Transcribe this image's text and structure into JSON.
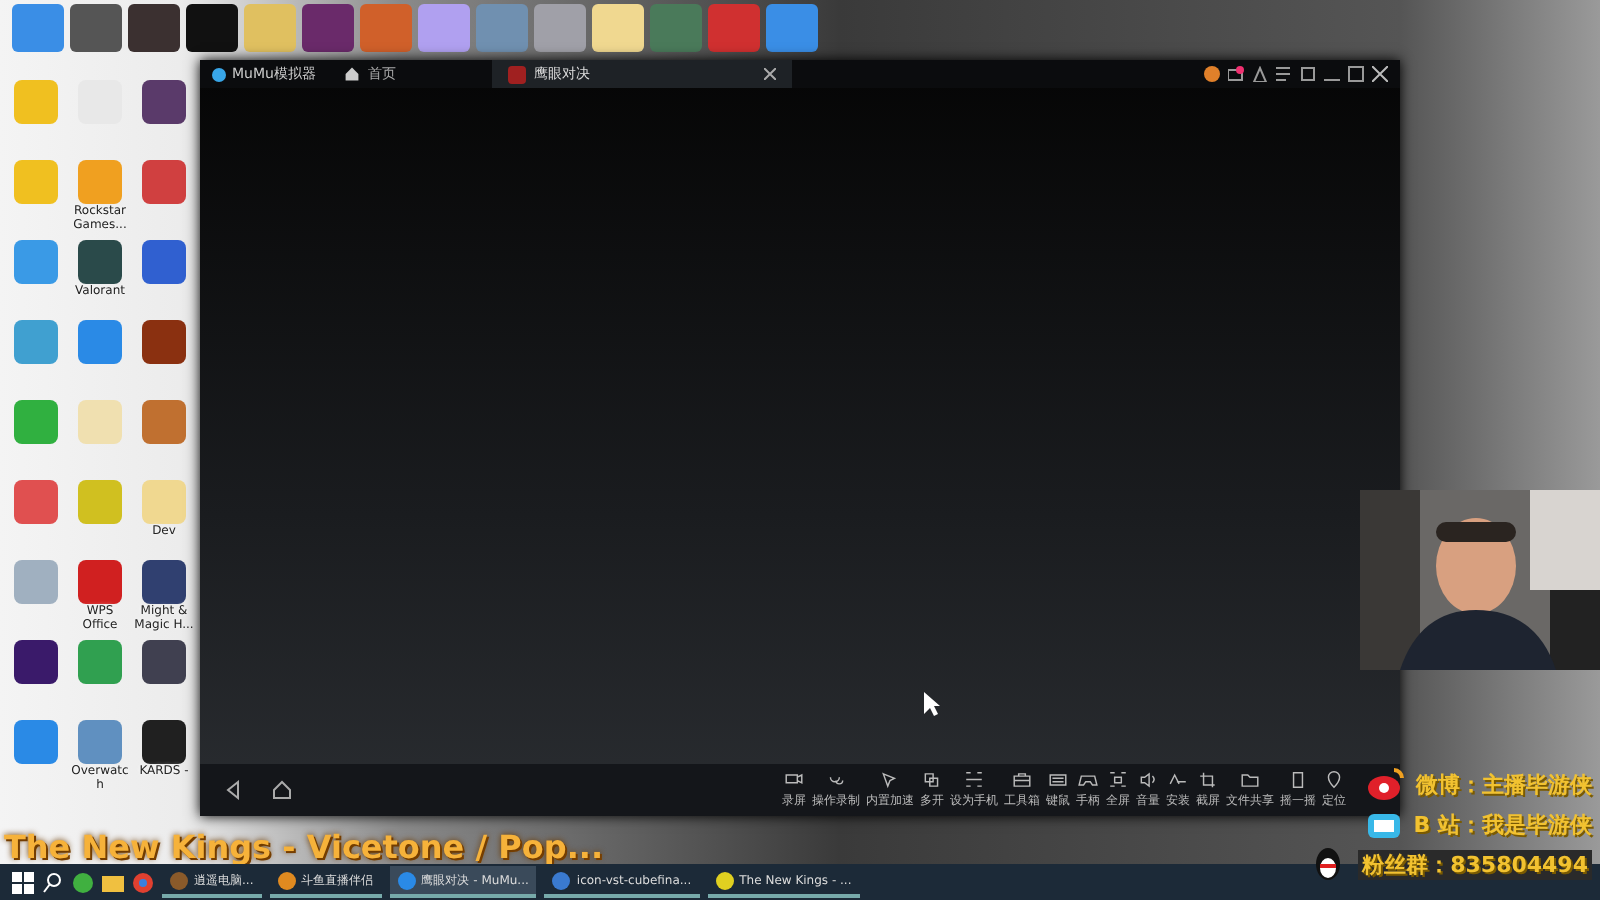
{
  "desktop_top_icons": [
    {
      "color": "#3a8ee6"
    },
    {
      "color": "#555555"
    },
    {
      "color": "#3b3030"
    },
    {
      "color": "#111111"
    },
    {
      "color": "#e0c060"
    },
    {
      "color": "#6a2a6a"
    },
    {
      "color": "#d0602a"
    },
    {
      "color": "#b0a0f0"
    },
    {
      "color": "#7090b0"
    },
    {
      "color": "#a0a0a8"
    },
    {
      "color": "#f0d890"
    },
    {
      "color": "#4a7a5a"
    },
    {
      "color": "#d03030"
    },
    {
      "color": "#3a8ee6"
    }
  ],
  "desktop_icons": [
    {
      "color": "#f0c020"
    },
    {
      "color": "#e8e8e8"
    },
    {
      "color": "#5a3a6a"
    },
    {
      "color": "#f0c020"
    },
    {
      "color": "#f0a020",
      "label": "Rockstar Games..."
    },
    {
      "color": "#d04040"
    },
    {
      "color": "#3a9ae6"
    },
    {
      "color": "#2a4a4a",
      "label": "Valorant"
    },
    {
      "color": "#3060d0"
    },
    {
      "color": "#40a0d0"
    },
    {
      "color": "#2a8ae6"
    },
    {
      "color": "#8a3010"
    },
    {
      "color": "#30b040"
    },
    {
      "color": "#f0e0b0"
    },
    {
      "color": "#c07030"
    },
    {
      "color": "#e05050"
    },
    {
      "color": "#d0c020"
    },
    {
      "color": "#f0d890",
      "label": "Dev"
    },
    {
      "color": "#a0b0c0"
    },
    {
      "color": "#d02020",
      "label": "WPS Office"
    },
    {
      "color": "#304070",
      "label": "Might & Magic H..."
    },
    {
      "color": "#3a1a6a"
    },
    {
      "color": "#30a050"
    },
    {
      "color": "#404050"
    },
    {
      "color": "#2a8ae6"
    },
    {
      "color": "#6090c0",
      "label": "Overwatch"
    },
    {
      "color": "#202020",
      "label": "KARDS -"
    }
  ],
  "emulator": {
    "title": "MuMu模拟器",
    "tabs": [
      {
        "label": "首页",
        "selected": false
      },
      {
        "label": "鹰眼对决",
        "selected": true
      }
    ],
    "toolbar": [
      "录屏",
      "操作录制",
      "内置加速",
      "多开",
      "设为手机",
      "工具箱",
      "键鼠",
      "手柄",
      "全屏",
      "音量",
      "安装",
      "截屏",
      "文件共享",
      "摇一摇",
      "定位"
    ]
  },
  "now_playing": "The New Kings - Vicetone / Pop...",
  "overlay": [
    {
      "kind": "weibo",
      "text": "微博：主播毕游侠"
    },
    {
      "kind": "bilibili",
      "text": "B 站：我是毕游侠"
    },
    {
      "kind": "qq",
      "text": "粉丝群：835804494"
    }
  ],
  "taskbar": {
    "apps": [
      {
        "label": "逍遥电脑...",
        "selected": false
      },
      {
        "label": "斗鱼直播伴侣",
        "selected": false
      },
      {
        "label": "鹰眼对决 - MuMu...",
        "selected": true
      },
      {
        "label": "icon-vst-cubefina...",
        "selected": false
      },
      {
        "label": "The New Kings - ...",
        "selected": false
      }
    ]
  }
}
